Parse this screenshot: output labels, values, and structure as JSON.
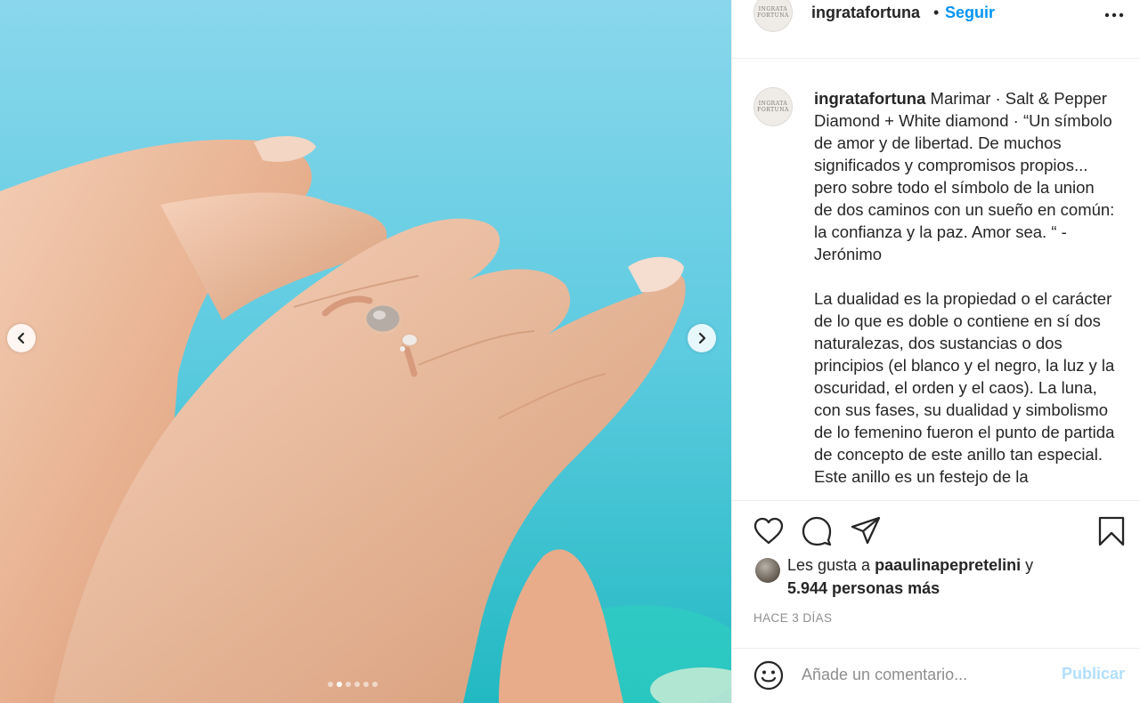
{
  "post": {
    "author": {
      "username": "ingratafortuna",
      "logo_line1": "INGRATA",
      "logo_line2": "FORTUNA"
    },
    "bullet": "•",
    "follow_label": "Seguir",
    "caption": {
      "username": "ingratafortuna",
      "paragraphs": [
        "Marimar · Salt & Pepper Diamond + White diamond · “Un símbolo de amor y de libertad. De muchos significados y compromisos propios... pero sobre todo el símbolo de la union de dos caminos con un sueño en común: la confianza y la paz. Amor sea. “ - Jerónimo",
        "La dualidad es la propiedad o el carácter de lo que es doble o contiene en sí dos naturalezas, dos sustancias o dos principios (el blanco y el negro, la luz y la oscuridad, el orden y el caos). La luna, con sus fases, su dualidad y simbolismo de lo femenino fueron el punto de partida de concepto de este anillo tan especial. Este anillo es un festejo de la"
      ]
    },
    "carousel": {
      "slide_count": 6,
      "active_index": 1
    },
    "likes": {
      "prefix": "Les gusta a",
      "user": "paaulinapepretelini",
      "suffix": "y",
      "others": "5.944 personas más"
    },
    "timestamp": "HACE 3 DÍAS",
    "comment": {
      "placeholder": "Añade un comentario...",
      "publish_label": "Publicar"
    }
  },
  "icons": {
    "prev": "chevron-left-icon",
    "next": "chevron-right-icon",
    "more": "more-options-icon",
    "like": "heart-icon",
    "comment": "comment-bubble-icon",
    "share": "paper-plane-icon",
    "save": "bookmark-icon",
    "emoji": "smiley-icon"
  },
  "colors": {
    "accent": "#0095f6",
    "publish_disabled": "#b2dffc",
    "muted": "#8e8e8e",
    "text": "#262626",
    "divider": "#efefef"
  }
}
